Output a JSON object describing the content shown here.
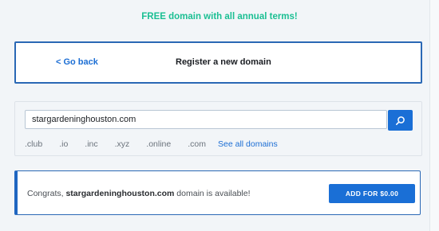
{
  "promo": {
    "text": "FREE domain with all annual terms!"
  },
  "header": {
    "back_label": "< Go back",
    "title": "Register a new domain"
  },
  "search": {
    "value": "stargardeninghouston.com",
    "button_icon": "search-icon",
    "tlds": [
      ".club",
      ".io",
      ".inc",
      ".xyz",
      ".online",
      ".com"
    ],
    "see_all_label": "See all domains"
  },
  "result": {
    "prefix": "Congrats, ",
    "domain": "stargardeninghouston.com",
    "suffix": " domain is available!",
    "button_label": "ADD FOR $0.00"
  },
  "colors": {
    "promo_green": "#1bbf93",
    "link_blue": "#1c6ed4",
    "button_blue": "#1a6fd6",
    "card_border": "#2a68b5",
    "page_bg": "#f2f5f8"
  }
}
